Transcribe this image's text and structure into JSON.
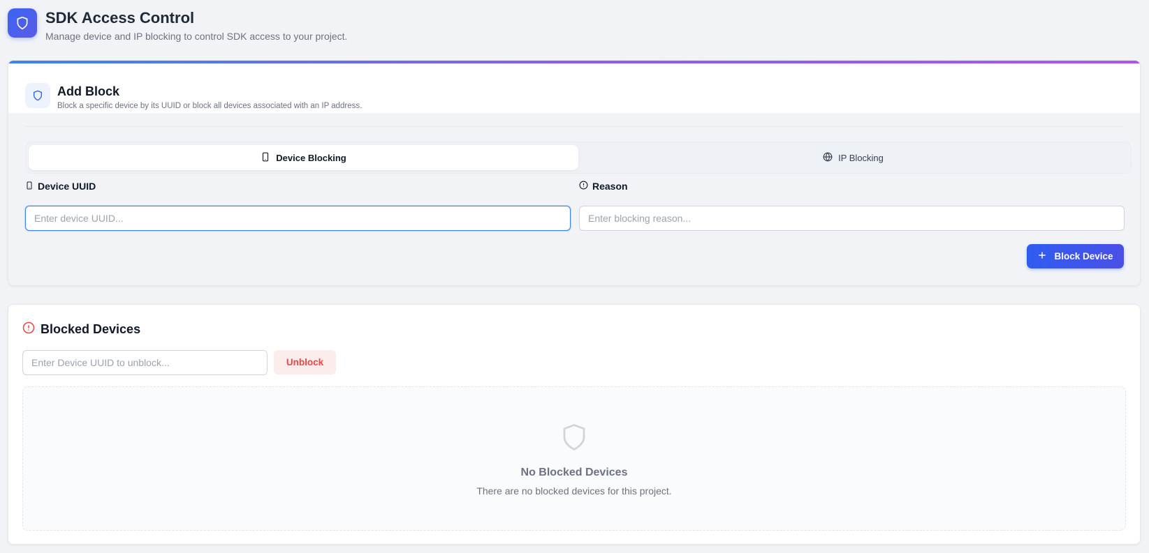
{
  "header": {
    "title": "SDK Access Control",
    "subtitle": "Manage device and IP blocking to control SDK access to your project.",
    "icon": "shield-icon",
    "accent": "#3b64f0"
  },
  "add_block": {
    "title": "Add Block",
    "description": "Block a specific device by its UUID or block all devices associated with an IP address.",
    "tabs": [
      {
        "label": "Device Blocking",
        "icon": "smartphone-icon",
        "active": true
      },
      {
        "label": "IP Blocking",
        "icon": "globe-icon",
        "active": false
      }
    ],
    "device_uuid": {
      "label": "Device UUID",
      "placeholder": "Enter device UUID...",
      "value": ""
    },
    "reason": {
      "label": "Reason",
      "placeholder": "Enter blocking reason...",
      "value": ""
    },
    "submit_label": "Block Device"
  },
  "blocked_devices": {
    "title": "Blocked Devices",
    "unblock_placeholder": "Enter Device UUID to unblock...",
    "unblock_label": "Unblock",
    "empty_title": "No Blocked Devices",
    "empty_description": "There are no blocked devices for this project."
  }
}
